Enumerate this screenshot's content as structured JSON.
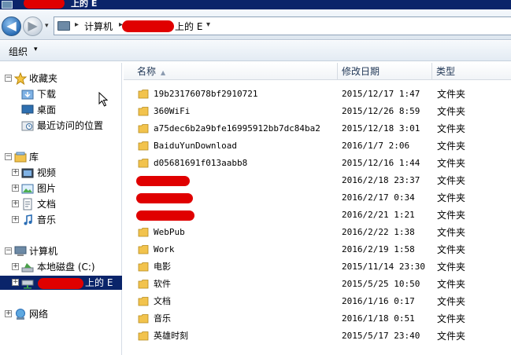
{
  "window": {
    "title_suffix": "上的 E"
  },
  "nav": {
    "back_glyph": "◀",
    "forward_glyph": "▶",
    "dropdown_glyph": "▾",
    "breadcrumb": {
      "sep": "▸",
      "computer": "计算机",
      "drive_suffix": "上的 E",
      "dropdown": "▾"
    }
  },
  "commandbar": {
    "organize": "组织",
    "dropdown": "▾"
  },
  "sidebar": {
    "favorites": "收藏夹",
    "downloads": "下载",
    "desktop": "桌面",
    "recent": "最近访问的位置",
    "libraries": "库",
    "videos": "视频",
    "pictures": "图片",
    "documents": "文档",
    "music": "音乐",
    "computer": "计算机",
    "local_disk": "本地磁盘 (C:)",
    "drive_e_suffix": "上的 E",
    "network": "网络",
    "expand_plus": "+",
    "expand_minus": "−"
  },
  "columns": {
    "name": "名称",
    "sort_glyph": "▲",
    "modified": "修改日期",
    "type": "类型"
  },
  "files": [
    {
      "name": "19b23176078bf2910721",
      "date": "2015/12/17 1:47",
      "type": "文件夹"
    },
    {
      "name": "360WiFi",
      "date": "2015/12/26 8:59",
      "type": "文件夹"
    },
    {
      "name": "a75dec6b2a9bfe16995912bb7dc84ba2",
      "date": "2015/12/18 3:01",
      "type": "文件夹"
    },
    {
      "name": "BaiduYunDownload",
      "date": "2016/1/7 2:06",
      "type": "文件夹"
    },
    {
      "name": "d05681691f013aabb8",
      "date": "2015/12/16 1:44",
      "type": "文件夹"
    },
    {
      "name": "",
      "date": "2016/2/18 23:37",
      "type": "文件夹"
    },
    {
      "name": "",
      "date": "2016/2/17 0:34",
      "type": "文件夹"
    },
    {
      "name": "",
      "date": "2016/2/21 1:21",
      "type": "文件夹"
    },
    {
      "name": "WebPub",
      "date": "2016/2/22 1:38",
      "type": "文件夹"
    },
    {
      "name": "Work",
      "date": "2016/2/19 1:58",
      "type": "文件夹"
    },
    {
      "name": "电影",
      "date": "2015/11/14 23:30",
      "type": "文件夹"
    },
    {
      "name": "软件",
      "date": "2015/5/25 10:50",
      "type": "文件夹"
    },
    {
      "name": "文档",
      "date": "2016/1/16 0:17",
      "type": "文件夹"
    },
    {
      "name": "音乐",
      "date": "2016/1/18 0:51",
      "type": "文件夹"
    },
    {
      "name": "英雄时刻",
      "date": "2015/5/17 23:40",
      "type": "文件夹"
    }
  ],
  "colors": {
    "selection": "#0a246a",
    "redaction": "#e00000",
    "folder": "#f2c34d"
  }
}
